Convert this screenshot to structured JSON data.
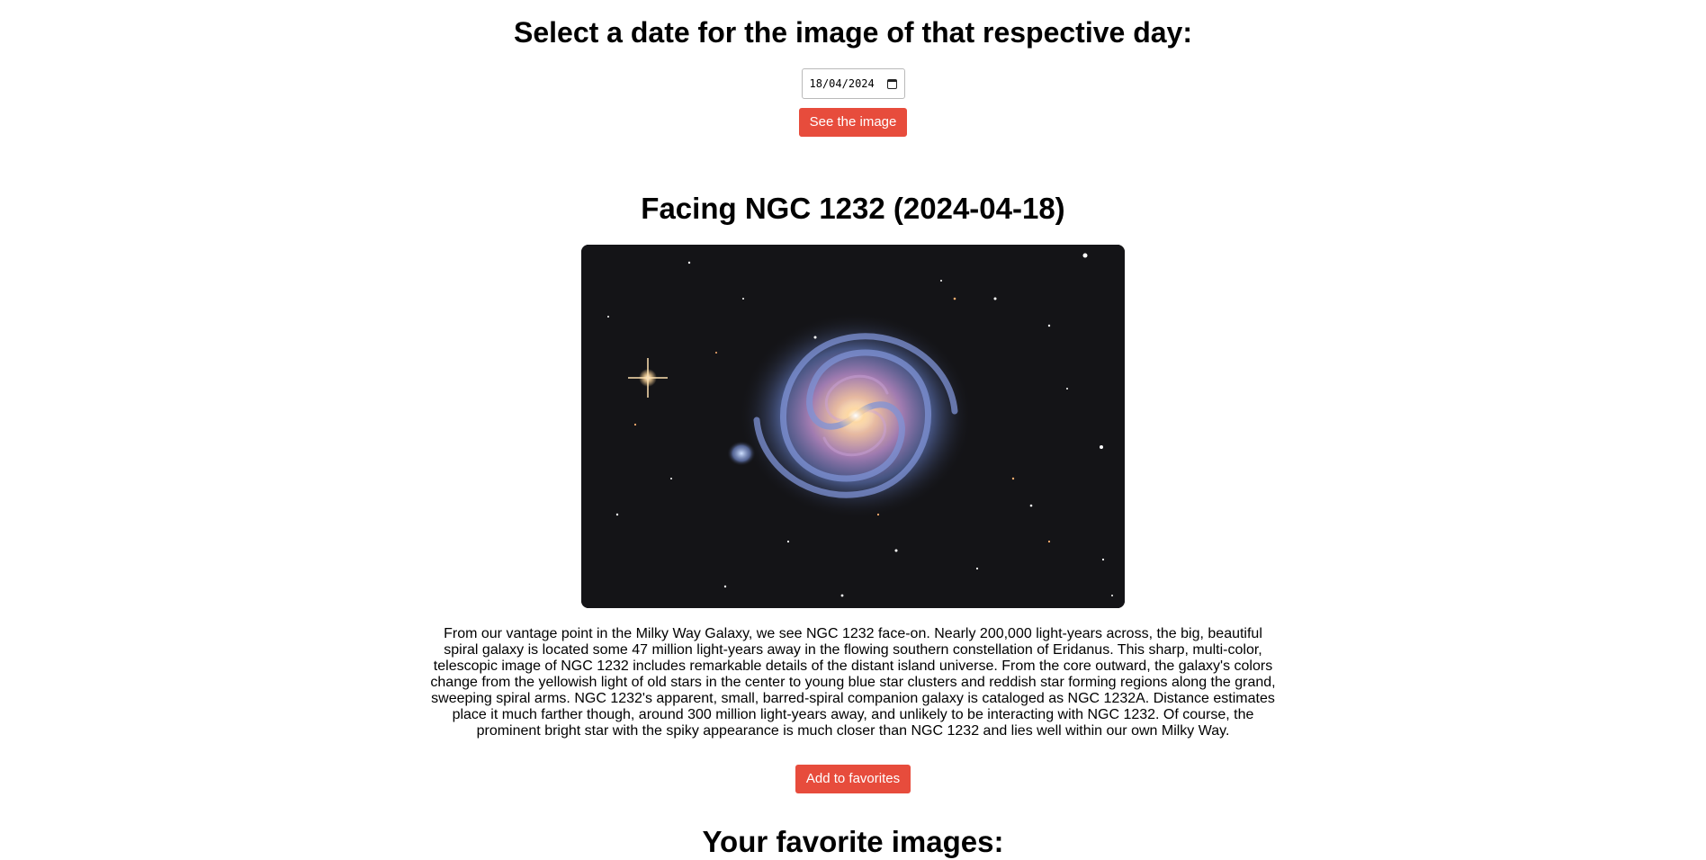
{
  "header": {
    "title": "Select a date for the image of that respective day:"
  },
  "date_picker": {
    "value": "18/04/2024",
    "icon": "calendar-icon"
  },
  "see_button": {
    "label": "See the image",
    "color": "#e74c3c"
  },
  "apod": {
    "title": "Facing NGC 1232 (2024-04-18)",
    "explanation": "From our vantage point in the Milky Way Galaxy, we see NGC 1232 face-on. Nearly 200,000 light-years across, the big, beautiful spiral galaxy is located some 47 million light-years away in the flowing southern constellation of Eridanus. This sharp, multi-color, telescopic image of NGC 1232 includes remarkable details of the distant island universe. From the core outward, the galaxy's colors change from the yellowish light of old stars in the center to young blue star clusters and reddish star forming regions along the grand, sweeping spiral arms. NGC 1232's apparent, small, barred-spiral companion galaxy is cataloged as NGC 1232A. Distance estimates place it much farther though, around 300 million light-years away, and unlikely to be interacting with NGC 1232. Of course, the prominent bright star with the spiky appearance is much closer than NGC 1232 and lies well within our own Milky Way."
  },
  "favorite_button": {
    "label": "Add to favorites"
  },
  "favorites": {
    "title": "Your favorite images:"
  }
}
